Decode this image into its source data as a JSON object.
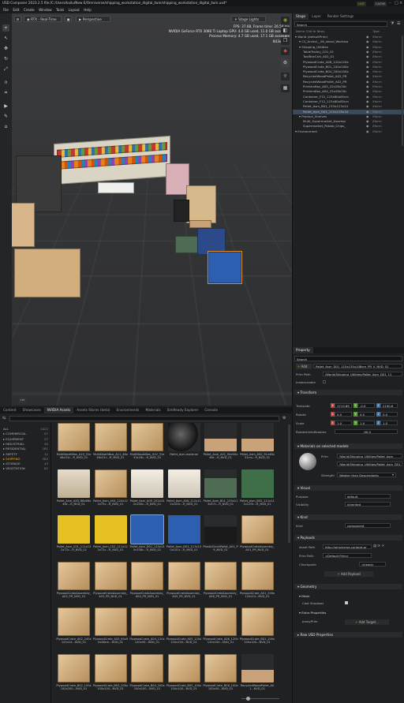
{
  "window": {
    "title": "USD Composer   2023.2.5   file:/C:/Users/kailu/New E/Omniverse/shipping_workstation_digital_twin/shipping_workstation_digital_twin.usd*",
    "live_label": "LIVE",
    "cache_label": "CACHE"
  },
  "menu": [
    "File",
    "Edit",
    "Create",
    "Window",
    "Tools",
    "Layout",
    "Help"
  ],
  "viewport": {
    "renderer_label": "RTX - Real-Time",
    "camera_label": "Perspective",
    "lights_label": "Stage Lights",
    "stats": "FPS: 37.68, Frame time: 26.54 ms\nNVIDIA GeForce RTX 3080 Ti Laptop GPU: 4.0 GB used, 11.0 GB available\nProcess Memory: 4.7 GB used, 17.1 GB available\n843x1463",
    "corner_badge": "cm"
  },
  "stage": {
    "tabs": [
      "Stage",
      "Layer",
      "Render Settings"
    ],
    "search_placeholder": "Search",
    "columns": {
      "name": "Name (Old to New)",
      "type": "Type"
    },
    "rows": [
      {
        "name": "World (defaultPrim)",
        "type": "Xform",
        "level": 0,
        "selected": false
      },
      {
        "name": "C3_Arvind__56_stand_Worksta",
        "type": "Xform",
        "level": 1,
        "selected": false
      },
      {
        "name": "Shipping_Utilities",
        "type": "Xform",
        "level": 1,
        "selected": false
      },
      {
        "name": "TableTrolley_C01_01",
        "type": "Xform",
        "level": 2,
        "selected": false
      },
      {
        "name": "ToolBoxCart_A02_01",
        "type": "Xform",
        "level": 2,
        "selected": false
      },
      {
        "name": "PlywoodCrate_A08_120x120x",
        "type": "Xform",
        "level": 2,
        "selected": false
      },
      {
        "name": "PlywoodCrate_B01_100x100x",
        "type": "Xform",
        "level": 2,
        "selected": false
      },
      {
        "name": "PlywoodCrate_B04_200x100x",
        "type": "Xform",
        "level": 2,
        "selected": false
      },
      {
        "name": "RecycledWoodPallet_A02_PR",
        "type": "Xform",
        "level": 2,
        "selected": false
      },
      {
        "name": "RecycledWoodPallet_A02_PR",
        "type": "Xform",
        "level": 2,
        "selected": false
      },
      {
        "name": "PrintersBox_A05_22x28x20c",
        "type": "Xform",
        "level": 2,
        "selected": false
      },
      {
        "name": "PrintersBox_A04_22x28x20c",
        "type": "Xform",
        "level": 2,
        "selected": false
      },
      {
        "name": "Container_F12_123x80x85cm",
        "type": "Xform",
        "level": 2,
        "selected": false
      },
      {
        "name": "Container_F12_123x80x85cm",
        "type": "Xform",
        "level": 2,
        "selected": false
      },
      {
        "name": "Pallet_Asm_B01_133x113x14",
        "type": "Xform",
        "level": 2,
        "selected": false
      },
      {
        "name": "Pallet_Asm_D01_115x135x10",
        "type": "Xform",
        "level": 2,
        "selected": true
      },
      {
        "name": "Product_Shelves",
        "type": "Xform",
        "level": 1,
        "selected": false
      },
      {
        "name": "Multi_Supermarket_Assemp",
        "type": "Xform",
        "level": 2,
        "selected": false
      },
      {
        "name": "Supermarket_Potato_Chips_",
        "type": "Xform",
        "level": 2,
        "selected": false
      },
      {
        "name": "Environment",
        "type": "Xform",
        "level": 0,
        "selected": false
      }
    ]
  },
  "property": {
    "tab": "Property",
    "search_placeholder": "Search",
    "add_label": "Add",
    "prim_name": "Pallet_Asm_D01_115x135x108cm_PR_V_NVD_01",
    "prim_path_label": "Prim Path",
    "prim_path": "/World/Shipping_Utilities/Pallet_Asm_D01_11",
    "instanceable_label": "Instanceable",
    "transform_header": "Transform",
    "translate_label": "Translate",
    "translate": [
      "1713.89",
      "-0.0",
      "2190.6"
    ],
    "rotate_label": "Rotate",
    "rotate": [
      "0.0",
      "0.0",
      "0.0"
    ],
    "scale_label": "Scale",
    "scale": [
      "1.0",
      "1.0",
      "1.0"
    ],
    "rotate_order_label": "RotateUnitsReadme",
    "rotate_order_value": "-90.0",
    "materials_header": "Materials on selected models",
    "prim_label": "Prim",
    "prim_value": "/World/Shipping_Utilities/Pallet_Asm",
    "material_value": "/World/Shipping_Utilities/Pallet_Asm_D01",
    "strength_label": "Strength",
    "strength_value": "Weaker than Descendants",
    "visual_header": "Visual",
    "purpose_label": "Purpose",
    "purpose_value": "default",
    "visibility_label": "Visibility",
    "visibility_value": "inherited",
    "kind_header": "Kind",
    "kind_label": "Kind",
    "kind_value": "component",
    "payloads_header": "Payloads",
    "asset_path_label": "Asset Path",
    "asset_path_value": "http://omniverse-content-pr",
    "prim_path2_label": "Prim Path",
    "prim_path2_value": "<Default Prim>",
    "checkpoint_label": "Checkpoint",
    "checkpoint_value": "<head>",
    "add_payload_label": "Add Payload",
    "geometry_header": "Geometry",
    "mesh_header": "Mesh",
    "cast_shadows_label": "Cast Shadows",
    "extra_header": "Extra Properties",
    "proxy_prim_label": "proxyPrim",
    "add_target_label": "Add Target...",
    "raw_header": "Raw USD Properties"
  },
  "content": {
    "tabs": [
      "Content",
      "Showcases",
      "NVIDIA Assets",
      "Assets Stores (beta)",
      "Environments",
      "Materials",
      "SimReady Explorer",
      "Console"
    ],
    "active_tab": "NVIDIA Assets",
    "categories": [
      {
        "name": "ALL",
        "count": "1022"
      },
      {
        "name": "COMMERCIAL",
        "count": "97"
      },
      {
        "name": "EQUIPMENT",
        "count": "57"
      },
      {
        "name": "INDUSTRIAL",
        "count": "40"
      },
      {
        "name": "RESIDENTIAL",
        "count": "181"
      },
      {
        "name": "SAFETY",
        "count": "12"
      },
      {
        "name": "SHIPPING",
        "count": "283"
      },
      {
        "name": "STORAGE",
        "count": "43"
      },
      {
        "name": "VEGETATION",
        "count": "82"
      }
    ],
    "active_category": "SHIPPING",
    "assets": [
      {
        "caption": "MultiDepthBox_A10_31x46x31c...R_NVD_01",
        "kind": "box"
      },
      {
        "caption": "MultiDepthBox_A11_46x46x31c...R_NVD_01",
        "kind": "box"
      },
      {
        "caption": "MultiDepthBox_A12_31x31x16c...R_NVD_01",
        "kind": "box"
      },
      {
        "caption": "Pallet_Asm.material",
        "kind": "sphere"
      },
      {
        "caption": "Pallet_Asm_A01_90x90x46c...R_NVD_01",
        "kind": "pallet"
      },
      {
        "caption": "Pallet_Asm_A02_91x46x31cm...R_NVD_01",
        "kind": "pallet"
      },
      {
        "caption": "Pallet_Asm_A03_66x66x46c...R_NVD_01",
        "kind": "bags"
      },
      {
        "caption": "Pallet_Asm_A04_120x122x75c...R_NVD_01",
        "kind": "crate"
      },
      {
        "caption": "Pallet_Asm_A05_102x102x100c...R_NVD_01",
        "kind": "wrapped"
      },
      {
        "caption": "Pallet_Asm_A06_112x112x100c...R_NVD_01",
        "kind": "wrapped"
      },
      {
        "caption": "Pallet_Asm_B01_133x113x47c...R_NVD_01",
        "kind": "green"
      },
      {
        "caption": "Pallet_Asm_B02_111x111x129c...R_NVD_01",
        "kind": "greentall"
      },
      {
        "caption": "Pallet_Asm_C01_111x132x72c...R_NVD_01",
        "kind": "yellow"
      },
      {
        "caption": "Pallet_Asm_C02_111x122x72c...R_NVD_01",
        "kind": "yellow"
      },
      {
        "caption": "Pallet_Asm_D01_115x135x108c...R_NVD_01",
        "kind": "blue",
        "selected": true
      },
      {
        "caption": "Pallet_Asm_D02_117x130x141c...R_NVD_01",
        "kind": "blue"
      },
      {
        "caption": "PlasticDrumPallet_A01_PR_NVD_01",
        "kind": "drum"
      },
      {
        "caption": "PlywoodCrateAssembly_A01_PR_NVD_01",
        "kind": "crate"
      },
      {
        "caption": "PlywoodCrateAssembly_A02_PR_NVD_01",
        "kind": "crate"
      },
      {
        "caption": "PlywoodCrateAssembly_A03_PR_NVD_01",
        "kind": "crate"
      },
      {
        "caption": "PlywoodCrateAssembly_A04_PR_NVD_01",
        "kind": "crate"
      },
      {
        "caption": "PlywoodCrateAssembly_A05_PR_NVD_01",
        "kind": "crate"
      },
      {
        "caption": "PlywoodCrateAssembly_A06_PR_NVD_01",
        "kind": "crate"
      },
      {
        "caption": "PlywoodCrate_A01_240x120x14...NVD_01",
        "kind": "crate"
      },
      {
        "caption": "PlywoodCrate_A02_240x120x14...NVD_01",
        "kind": "crate"
      },
      {
        "caption": "PlywoodCrate_A03_90x90x46cm...NVD_01",
        "kind": "crate"
      },
      {
        "caption": "PlywoodCrate_A04_120x120x50...NVD_01",
        "kind": "crate"
      },
      {
        "caption": "PlywoodCrate_A05_120x120x100...NVD_01",
        "kind": "crate"
      },
      {
        "caption": "PlywoodCrate_A06_120x120x100...NVD_01",
        "kind": "crate"
      },
      {
        "caption": "PlywoodCrate_B01_100x100x100...NVD_01",
        "kind": "crate"
      },
      {
        "caption": "PlywoodCrate_B02_100x100x200...NVD_01",
        "kind": "crate"
      },
      {
        "caption": "PlywoodCrate_B03_200x100x100...NVD_01",
        "kind": "crate"
      },
      {
        "caption": "PlywoodCrate_B04_200x100x100...NVD_01",
        "kind": "crate"
      },
      {
        "caption": "PlywoodCrate_B05_100x100x100...NVD_01",
        "kind": "crate"
      },
      {
        "caption": "PlywoodCrate_B06_100x100x50...NVD_01",
        "kind": "crate"
      },
      {
        "caption": "RecycledWoodPallet_A01...NVD_01",
        "kind": "pallet"
      }
    ]
  },
  "colors": {
    "accent": "#76b900",
    "selection": "#3a4a5c",
    "panel": "#1f2022",
    "x": "#c4413a",
    "y": "#5a9a3b",
    "z": "#3a6db0"
  }
}
